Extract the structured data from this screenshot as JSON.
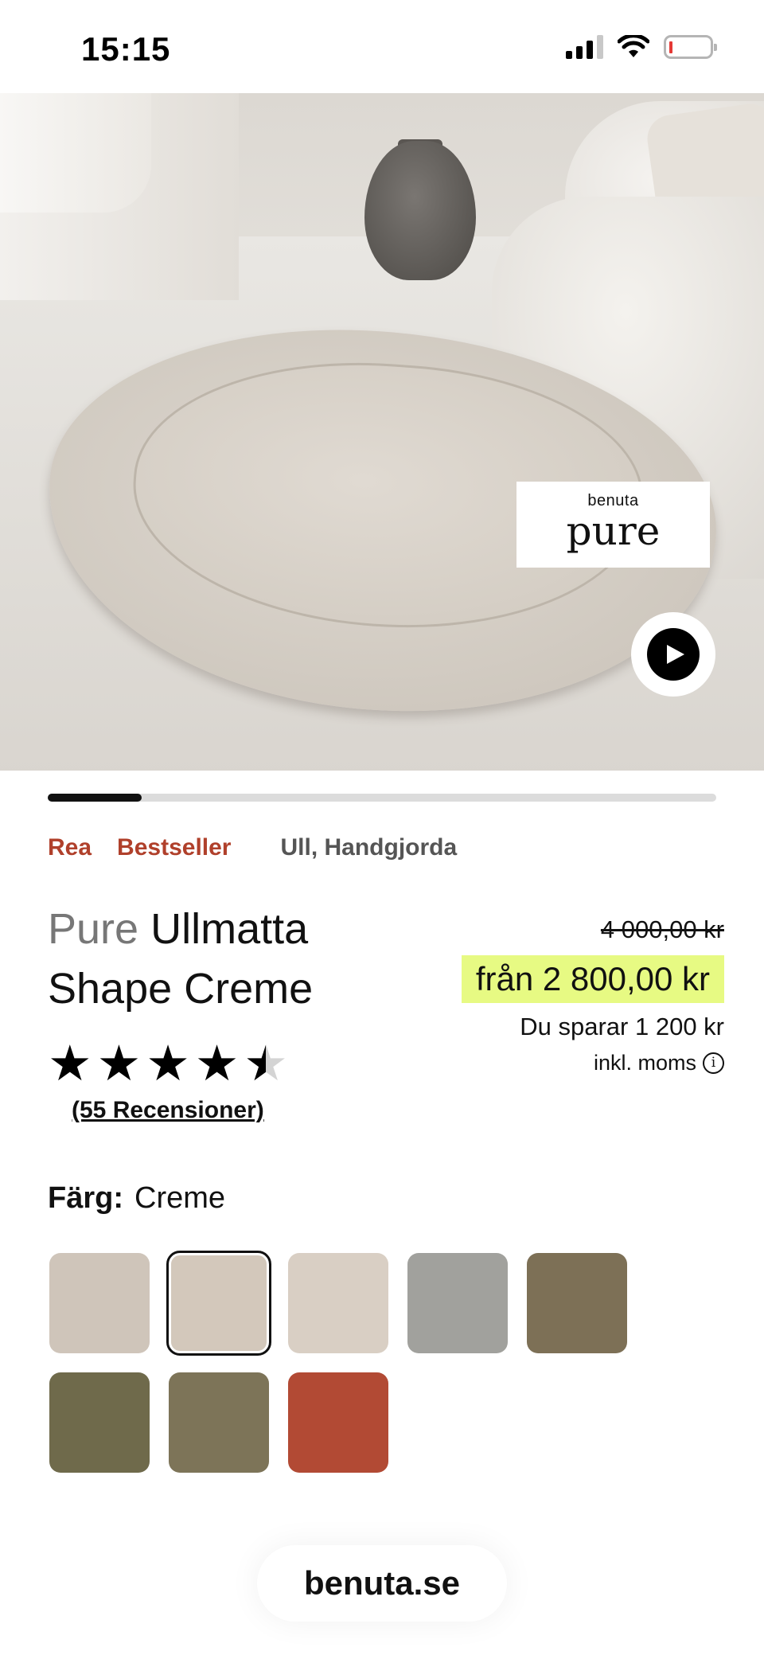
{
  "status_bar": {
    "time": "15:15",
    "battery_level_fraction": 0.05
  },
  "hero": {
    "badge_brand_small": "benuta",
    "badge_brand_big": "pure",
    "play_icon": "play-icon",
    "gallery_progress_fraction": 0.14
  },
  "tags": {
    "sale": "Rea",
    "bestseller": "Bestseller",
    "attributes": "Ull, Handgjorda"
  },
  "product": {
    "brand": "Pure",
    "name": "Ullmatta Shape Creme"
  },
  "pricing": {
    "old_price": "4 000,00 kr",
    "current_price": "från 2 800,00 kr",
    "savings": "Du sparar 1 200 kr",
    "vat_note": "inkl. moms",
    "highlight_color": "#e7fa83"
  },
  "rating": {
    "stars": 4.5,
    "max": 5,
    "reviews_label": "(55 Recensioner)"
  },
  "color": {
    "label": "Färg:",
    "selected": "Creme",
    "swatches": [
      "#cfc5ba",
      "#d3c8bb",
      "#d9cfc4",
      "#a1a19d",
      "#7d7056",
      "#6f6a4b",
      "#7d7458",
      "#b24a34"
    ],
    "selected_index": 1
  },
  "footer": {
    "site": "benuta.se"
  }
}
